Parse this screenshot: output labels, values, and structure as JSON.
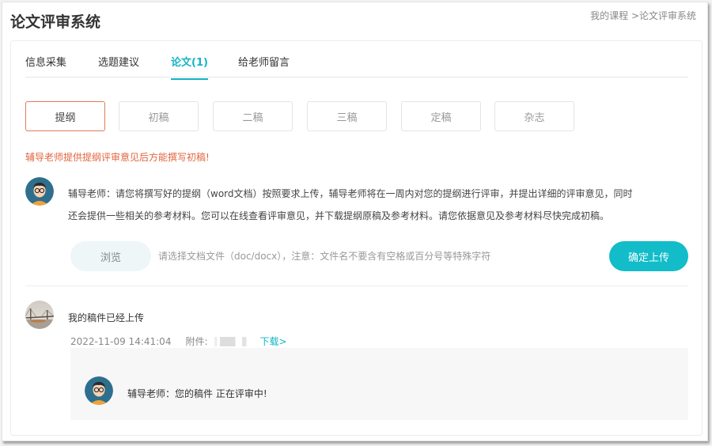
{
  "page": {
    "title": "论文评审系统",
    "breadcrumb": {
      "home": "我的课程",
      "current": ">论文评审系统"
    }
  },
  "tabs": [
    {
      "label": "信息采集",
      "active": false
    },
    {
      "label": "选题建议",
      "active": false
    },
    {
      "label": "论文(1)",
      "active": true
    },
    {
      "label": "给老师留言",
      "active": false
    }
  ],
  "stages": [
    {
      "label": "提纲",
      "active": true
    },
    {
      "label": "初稿",
      "active": false
    },
    {
      "label": "二稿",
      "active": false
    },
    {
      "label": "三稿",
      "active": false
    },
    {
      "label": "定稿",
      "active": false
    },
    {
      "label": "杂志",
      "active": false
    }
  ],
  "warning": "辅导老师提供提纲评审意见后方能撰写初稿!",
  "instruction": {
    "line1": "辅导老师：请您将撰写好的提纲（word文档）按照要求上传，辅导老师将在一周内对您的提纲进行评审，并提出详细的评审意见，同时",
    "line2": "还会提供一些相关的参考材料。您可以在线查看评审意见，并下载提纲原稿及参考材料。请您依据意见及参考材料尽快完成初稿。"
  },
  "upload": {
    "browse_label": "浏览",
    "hint": "请选择文档文件（doc/docx），注意：文件名不要含有空格或百分号等特殊字符",
    "submit_label": "确定上传"
  },
  "submission": {
    "message": "我的稿件已经上传",
    "time": "2022-11-09 14:41:04",
    "attachment_label": "附件:",
    "download_label": "下载>"
  },
  "reply": {
    "text": "辅导老师：您的稿件 正在评审中!"
  },
  "colors": {
    "accent": "#13bcc9",
    "warning": "#e2653f",
    "active_stage_border": "#e07b5a"
  }
}
